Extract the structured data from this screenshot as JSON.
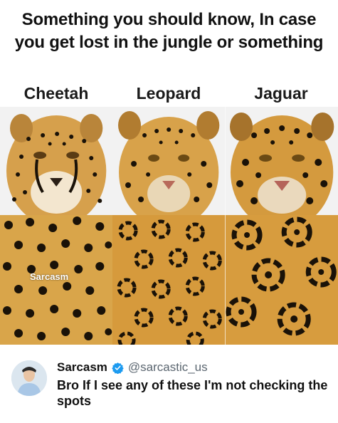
{
  "headline": {
    "line1": "Something you should know, In case",
    "line2": "you get lost in the jungle or something"
  },
  "columns": [
    {
      "label": "Cheetah",
      "image": "cheetah face photo",
      "coat": "cheetah coat solid round spots"
    },
    {
      "label": "Leopard",
      "image": "leopard face photo",
      "coat": "leopard coat rosettes without center dots"
    },
    {
      "label": "Jaguar",
      "image": "jaguar face photo",
      "coat": "jaguar coat large rosettes with center dots"
    }
  ],
  "watermark": "Sarcasm",
  "tweet": {
    "name": "Sarcasm",
    "handle": "@sarcastic_us",
    "text": "Bro If I see any of these I'm not checking the spots",
    "verified_color": "#1d9bf0"
  },
  "colors": {
    "fur": "#d9a54a",
    "spot": "#1a1208"
  }
}
